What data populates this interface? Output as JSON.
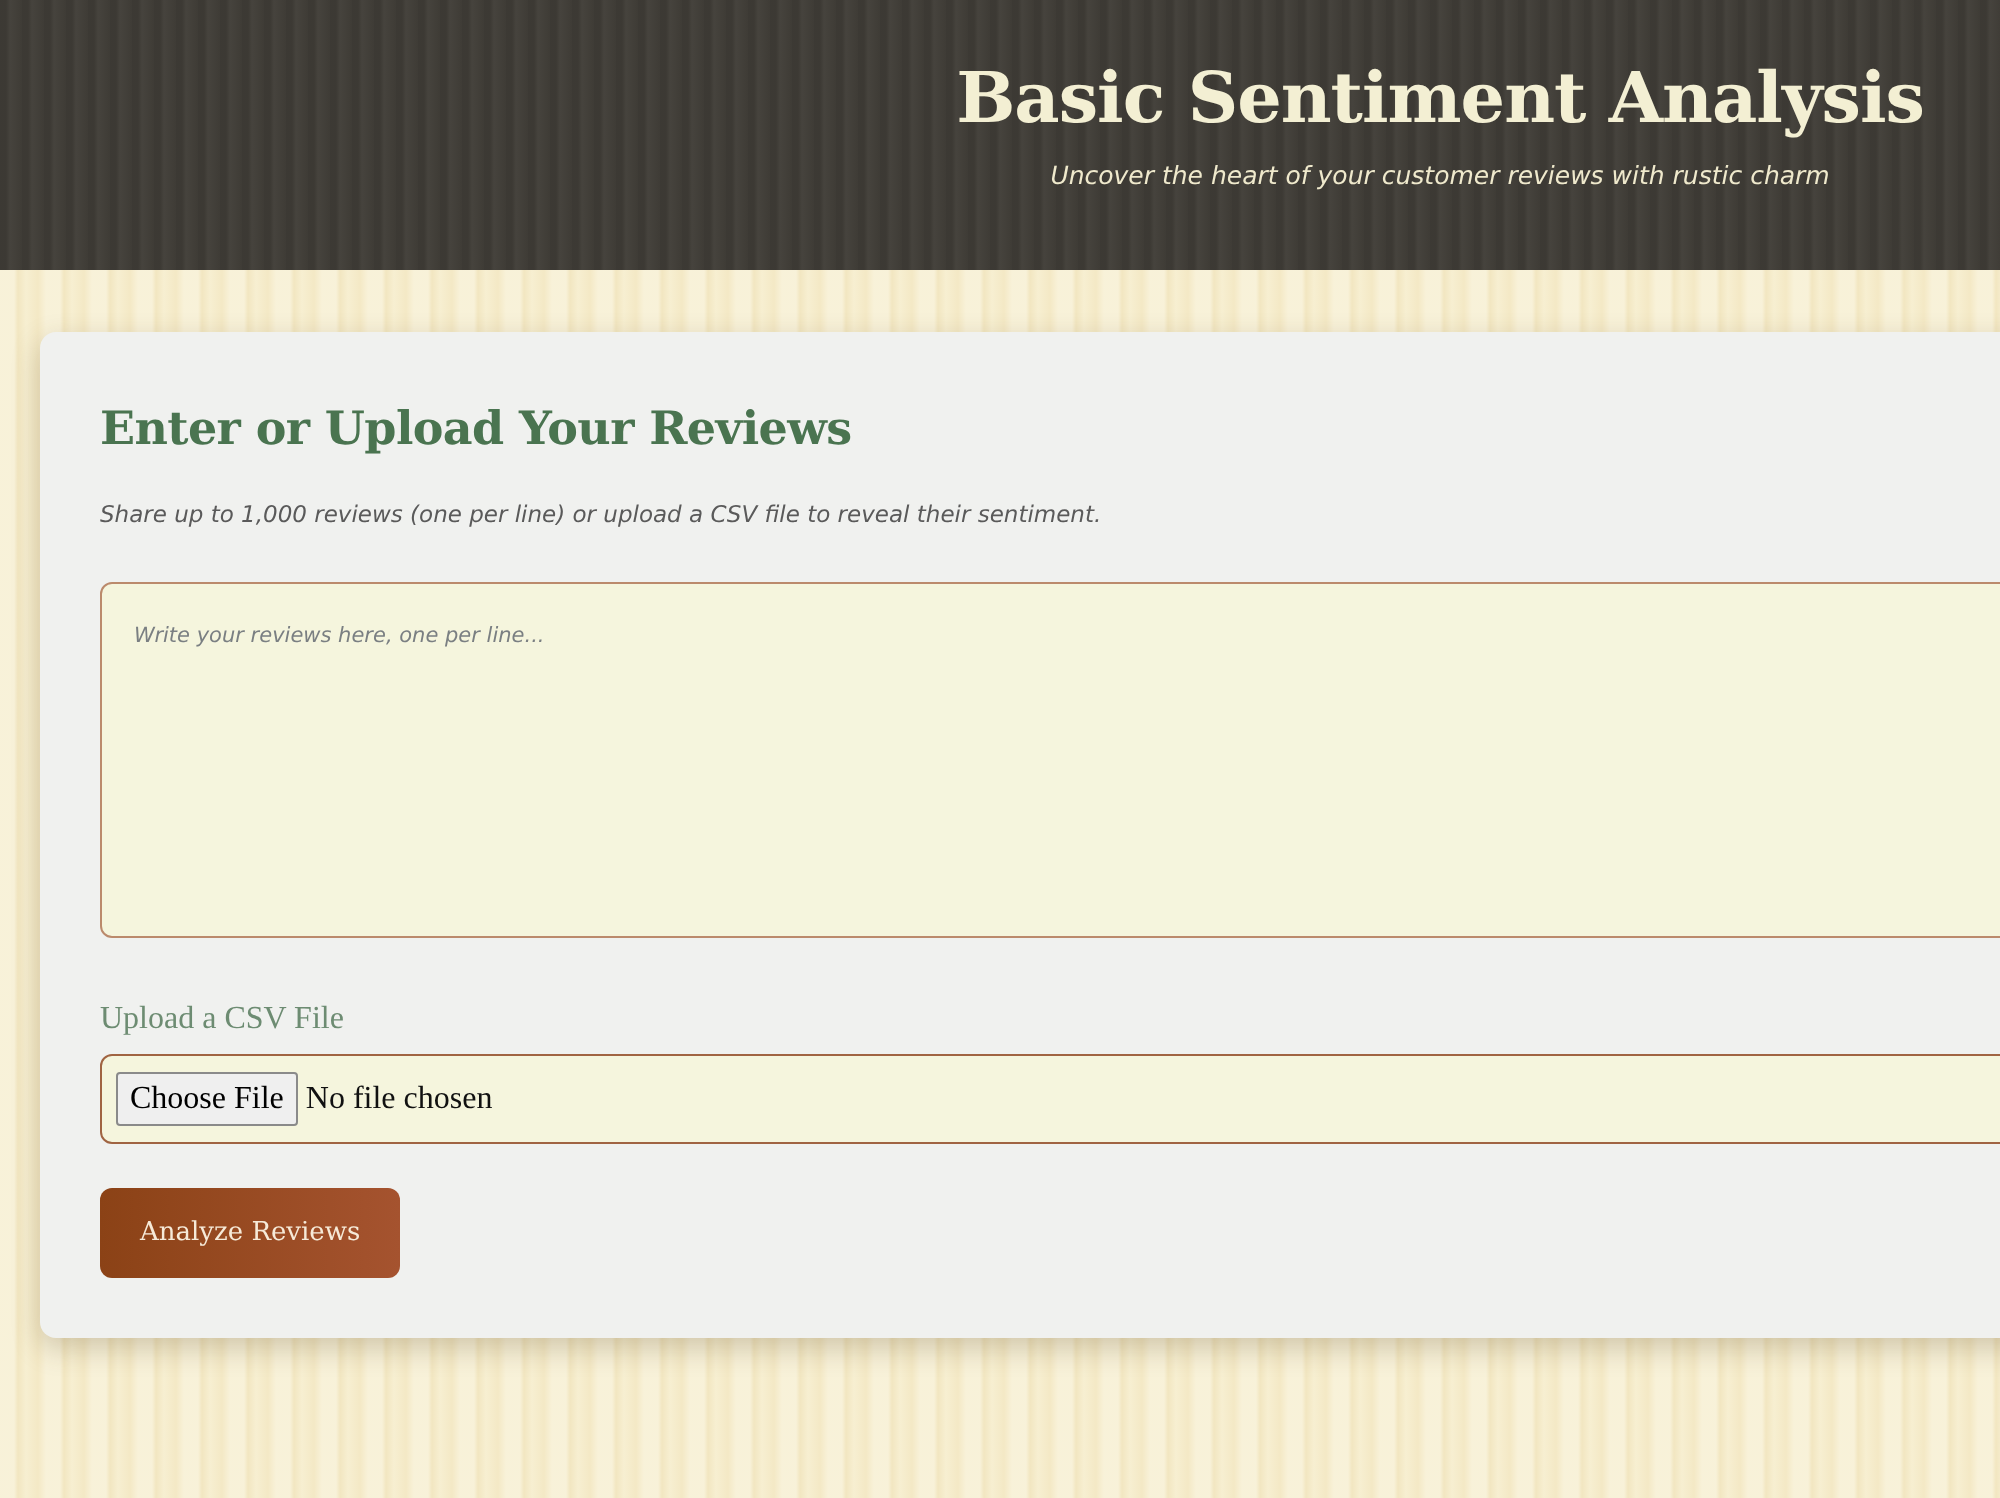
{
  "header": {
    "title": "Basic Sentiment Analysis",
    "subtitle": "Uncover the heart of your customer reviews with rustic charm"
  },
  "card": {
    "heading": "Enter or Upload Your Reviews",
    "description": "Share up to 1,000 reviews (one per line) or upload a CSV file to reveal their sentiment.",
    "reviews_field": {
      "placeholder": "Write your reviews here, one per line..."
    },
    "upload": {
      "label": "Upload a CSV File",
      "button": "Choose File",
      "status": "No file chosen"
    },
    "submit_button": "Analyze Reviews"
  }
}
